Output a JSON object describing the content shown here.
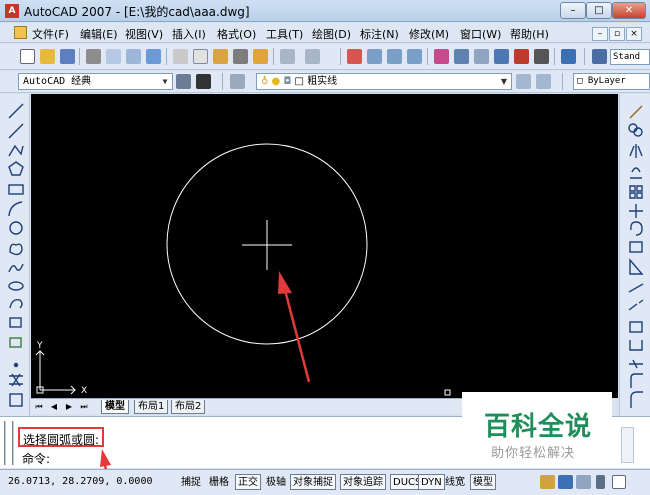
{
  "window": {
    "title": "AutoCAD 2007 - [E:\\我的cad\\aaa.dwg]",
    "app_icon": "autocad-logo-icon",
    "minimize_symbol": "–",
    "maximize_symbol": "□",
    "close_symbol": "✕"
  },
  "menu": {
    "items": [
      "文件(F)",
      "编辑(E)",
      "视图(V)",
      "插入(I)",
      "格式(O)",
      "工具(T)",
      "绘图(D)",
      "标注(N)",
      "修改(M)",
      "窗口(W)",
      "帮助(H)"
    ],
    "mdi": [
      "–",
      "▫",
      "×"
    ]
  },
  "toolbar1": {
    "style_field": "Stand"
  },
  "toolbar2": {
    "workspace": "AutoCAD 经典",
    "layer_name": "粗实线",
    "linetype": "ByLayer"
  },
  "canvas": {
    "background": "#000000",
    "entity_color": "#ffffff",
    "ucs_y": "Y",
    "ucs_x": "X"
  },
  "tabs": {
    "nav": [
      "⏮",
      "◀",
      "▶",
      "⏭"
    ],
    "items": [
      "模型",
      "布局1",
      "布局2"
    ]
  },
  "command": {
    "prompt": "选择圆弧或圆:",
    "line2": "命令:",
    "highlight_color": "#e03a3a"
  },
  "watermark": {
    "title": "百科全说",
    "subtitle": "助你轻松解决",
    "title_color": "#1f8e5b"
  },
  "status": {
    "coords": "26.0713, 28.2709, 0.0000",
    "modes": [
      "捕捉",
      "栅格",
      "正交",
      "极轴",
      "对象捕捉",
      "对象追踪",
      "DUCS",
      "DYN",
      "线宽",
      "模型"
    ]
  },
  "annotation": {
    "arrow_color": "#e03a3a"
  }
}
